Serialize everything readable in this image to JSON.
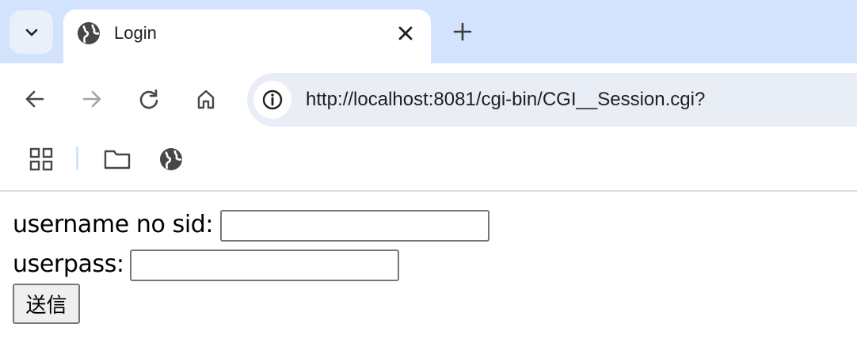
{
  "browser": {
    "tab": {
      "title": "Login"
    },
    "address_bar": {
      "url": "http://localhost:8081/cgi-bin/CGI__Session.cgi?"
    },
    "icons": {
      "tab_search": "chevron-down-icon",
      "favicon": "globe-icon",
      "close": "close-icon",
      "new_tab": "plus-icon",
      "back": "arrow-left-icon",
      "forward": "arrow-right-icon",
      "reload": "reload-icon",
      "home": "home-icon",
      "site_info": "info-icon",
      "apps": "apps-grid-icon",
      "folder": "folder-icon",
      "bookmark_globe": "globe-icon"
    },
    "colors": {
      "tabstrip": "#d3e3fd",
      "omnibox": "#e9eef6",
      "icon": "#474747",
      "icon_disabled": "#a0a4a8"
    }
  },
  "form": {
    "username_label": "username no sid:",
    "username_value": "",
    "userpass_label": "userpass:",
    "userpass_value": "",
    "submit_label": "送信"
  }
}
